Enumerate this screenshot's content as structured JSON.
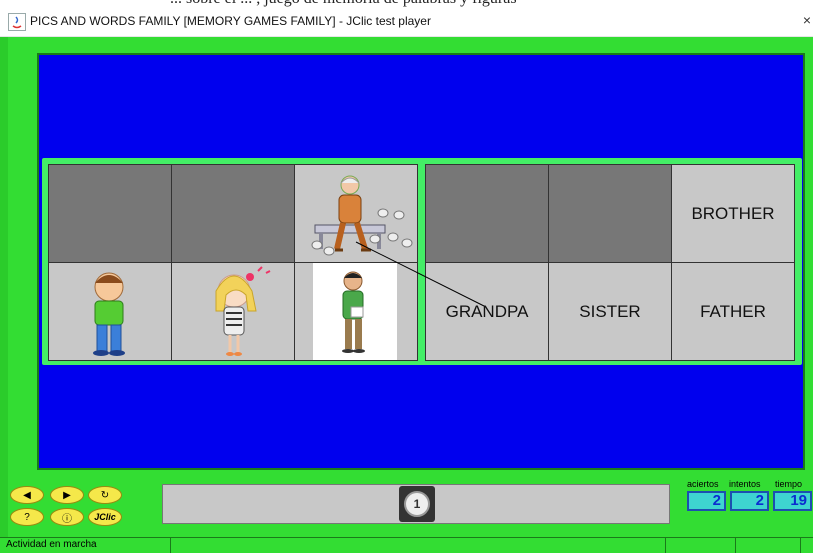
{
  "window": {
    "title": "PICS AND WORDS FAMILY [MEMORY GAMES FAMILY] - JClic test player",
    "close_glyph": "×",
    "top_strip_text": "... sobre el ... , juego de memoria de palabras y figuras"
  },
  "board": {
    "left_cards": [
      {
        "state": "hidden",
        "picture": ""
      },
      {
        "state": "hidden",
        "picture": ""
      },
      {
        "state": "shown",
        "picture": "grandpa-picture"
      },
      {
        "state": "shown",
        "picture": "brother-picture"
      },
      {
        "state": "shown",
        "picture": "sister-picture"
      },
      {
        "state": "shown",
        "picture": "father-picture"
      }
    ],
    "right_cards": [
      {
        "state": "hidden",
        "label": ""
      },
      {
        "state": "hidden",
        "label": ""
      },
      {
        "state": "shown",
        "label": "BROTHER"
      },
      {
        "state": "shown",
        "label": "GRANDPA"
      },
      {
        "state": "shown",
        "label": "SISTER"
      },
      {
        "state": "shown",
        "label": "FATHER"
      }
    ]
  },
  "controls": {
    "prev_icon": "◀",
    "next_icon": "▶",
    "reset_icon": "↻",
    "help_icon": "?",
    "info_icon": "ⓘ",
    "jclic_label": "JClic"
  },
  "reel": {
    "number": "1"
  },
  "counters": {
    "aciertos_label": "aciertos",
    "intentos_label": "intentos",
    "tiempo_label": "tiempo",
    "aciertos": "2",
    "intentos": "2",
    "tiempo": "19"
  },
  "status": {
    "text": "Actividad en marcha"
  },
  "colors": {
    "frame_green": "#33dd33",
    "stage_blue": "#0000ee",
    "hidden_card": "#777777",
    "shown_card": "#c8c8c8",
    "counter_text": "#0b2cd0"
  }
}
